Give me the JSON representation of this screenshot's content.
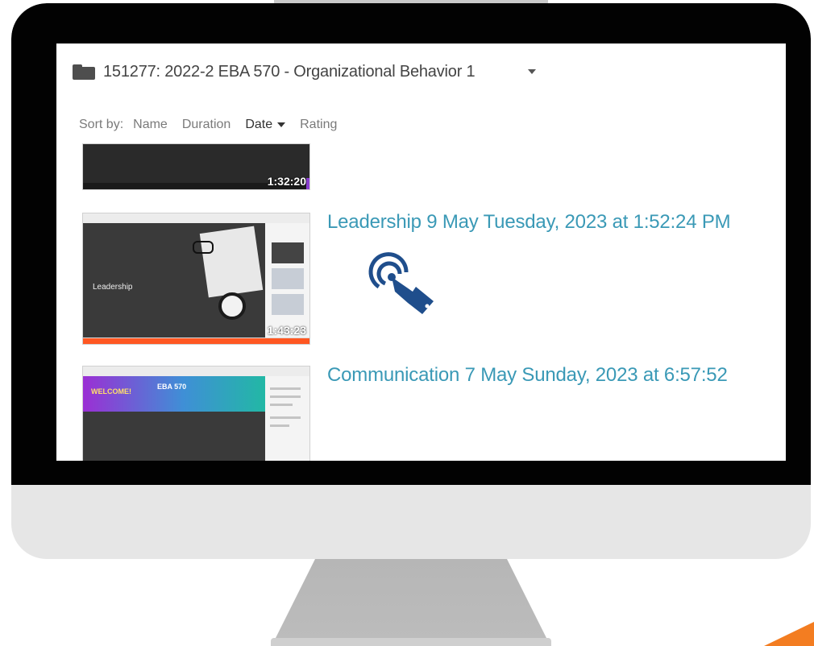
{
  "folder": {
    "title": "151277: 2022-2 EBA 570 - Organizational Behavior 1"
  },
  "sort": {
    "label": "Sort by:",
    "options": [
      "Name",
      "Duration",
      "Date",
      "Rating"
    ],
    "active": "Date"
  },
  "videos": [
    {
      "title": "",
      "duration": "1:32:20"
    },
    {
      "title": "Leadership 9 May Tuesday, 2023 at 1:52:24 PM",
      "duration": "1:43:23",
      "slide_title": "Leadership"
    },
    {
      "title": "Communication 7 May Sunday, 2023 at 6:57:52",
      "banner_text": "WELCOME!",
      "course_text": "EBA 570"
    }
  ],
  "icons": {
    "folder": "folder-icon",
    "caret": "chevron-down-icon",
    "cursor": "tap-hand-icon"
  },
  "colors": {
    "link": "#3a99b6",
    "progress": "#ff5722",
    "accent": "#f37d21",
    "cursor": "#1f4e8c"
  }
}
